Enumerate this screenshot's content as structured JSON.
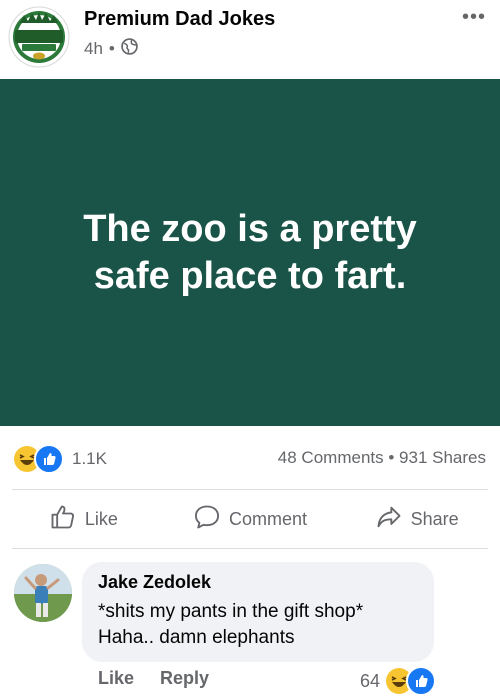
{
  "post": {
    "page_name": "Premium Dad Jokes",
    "time": "4h",
    "separator": "•",
    "privacy_icon": "globe-icon",
    "more_label": "•••",
    "logo": {
      "top_text": "PREMIUM",
      "bottom_text": "DAD JOKES"
    },
    "image_text": "The zoo is a pretty safe place to fart.",
    "image_bg": "#1a5448"
  },
  "stats": {
    "reaction_icons": [
      "haha-icon",
      "like-icon"
    ],
    "reaction_count": "1.1K",
    "comments": "48 Comments",
    "dot": "•",
    "shares": "931 Shares"
  },
  "actions": {
    "like": "Like",
    "comment": "Comment",
    "share": "Share"
  },
  "comment": {
    "author": "Jake Zedolek",
    "line1": "*shits my pants in the gift shop*",
    "line2": "Haha.. damn elephants",
    "like": "Like",
    "reply": "Reply",
    "reaction_count": "64"
  }
}
